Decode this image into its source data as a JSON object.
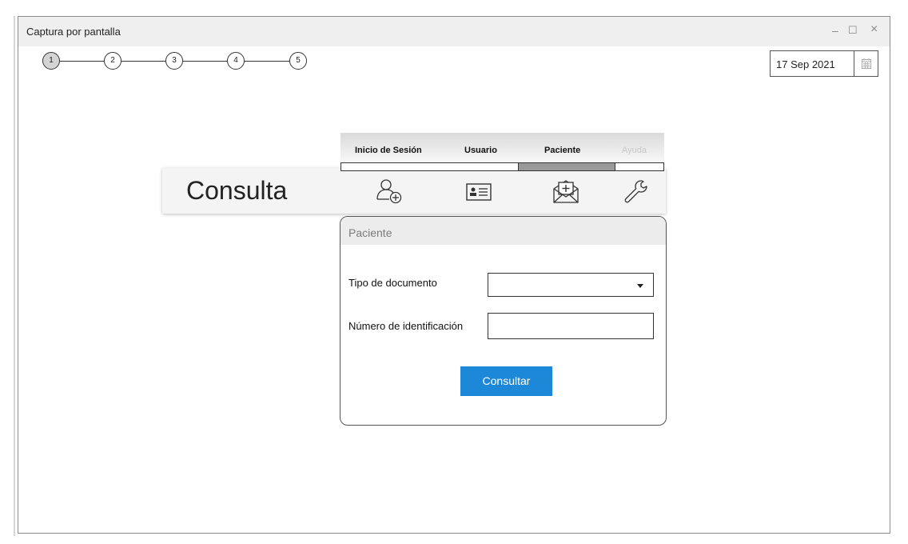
{
  "window": {
    "title": "Captura por pantalla",
    "minimize": "–",
    "maximize": "☐",
    "close": "×"
  },
  "stepper": {
    "steps": [
      "1",
      "2",
      "3",
      "4",
      "5"
    ],
    "active_index": 0
  },
  "date": {
    "value": "17 Sep 2021",
    "icon": "calendar-icon"
  },
  "panel": {
    "title": "Consulta"
  },
  "tabs": {
    "items": [
      {
        "label": "Inicio de Sesión",
        "enabled": true
      },
      {
        "label": "Usuario",
        "enabled": true
      },
      {
        "label": "Paciente",
        "enabled": true
      },
      {
        "label": "Ayuda",
        "enabled": false
      }
    ],
    "selected_index": 2,
    "icons": [
      "add-user-icon",
      "id-card-icon",
      "medical-mail-icon",
      "wrench-icon"
    ]
  },
  "form": {
    "title": "Paciente",
    "document_type_label": "Tipo de documento",
    "document_type_value": "",
    "id_number_label": "Número de identificación",
    "id_number_value": "",
    "submit_label": "Consultar"
  },
  "colors": {
    "accent": "#1E88D8",
    "active_step": "#D4D4D4",
    "tab_indicator": "#9A9A9A"
  }
}
